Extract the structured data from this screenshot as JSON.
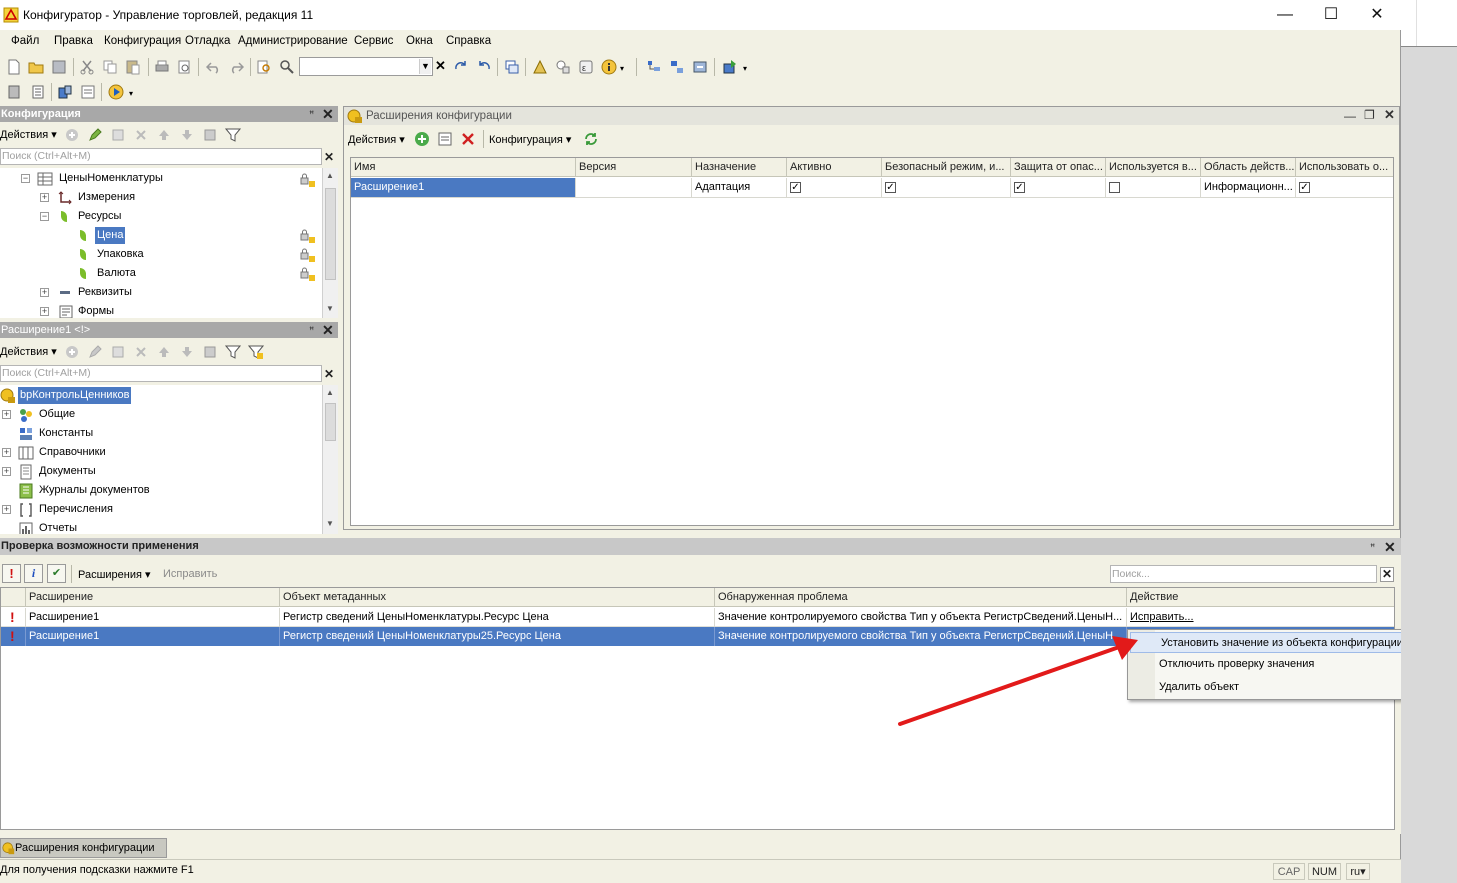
{
  "window": {
    "title": "Конфигуратор - Управление торговлей, редакция 11",
    "minimize": "—",
    "maximize": "☐",
    "close": "✕"
  },
  "menu": [
    "Файл",
    "Правка",
    "Конфигурация",
    "Отладка",
    "Администрирование",
    "Сервис",
    "Окна",
    "Справка"
  ],
  "config_panel": {
    "title": "Конфигурация",
    "actions": "Действия",
    "search_placeholder": "Поиск (Ctrl+Alt+M)",
    "tree": [
      {
        "label": "ЦеныНоменклатуры",
        "expander": "⊖",
        "locked": true
      },
      {
        "label": "Измерения",
        "expander": "⊕"
      },
      {
        "label": "Ресурсы",
        "expander": "⊖"
      },
      {
        "label": "Цена",
        "selected": true,
        "locked": true
      },
      {
        "label": "Упаковка",
        "locked": true
      },
      {
        "label": "Валюта",
        "locked": true
      },
      {
        "label": "Реквизиты",
        "expander": "⊕"
      },
      {
        "label": "Формы",
        "expander": "⊕"
      }
    ]
  },
  "ext_panel": {
    "title": "Расширение1 <!>",
    "actions": "Действия",
    "search_placeholder": "Поиск (Ctrl+Alt+M)",
    "tree": [
      {
        "label": "bpКонтрольЦенников",
        "selected": true
      },
      {
        "label": "Общие",
        "expander": "⊕"
      },
      {
        "label": "Константы"
      },
      {
        "label": "Справочники",
        "expander": "⊕"
      },
      {
        "label": "Документы",
        "expander": "⊕"
      },
      {
        "label": "Журналы документов"
      },
      {
        "label": "Перечисления",
        "expander": "⊕"
      },
      {
        "label": "Отчеты"
      }
    ]
  },
  "extensions_window": {
    "title": "Расширения конфигурации",
    "actions": "Действия",
    "configuration": "Конфигурация",
    "columns": [
      "Имя",
      "Версия",
      "Назначение",
      "Активно",
      "Безопасный режим, и...",
      "Защита от опас...",
      "Используется в...",
      "Область действ...",
      "Использовать о..."
    ],
    "row": {
      "name": "Расширение1",
      "version": "",
      "purpose": "Адаптация",
      "active": true,
      "safe_mode": true,
      "protection": true,
      "used_in": false,
      "scope": "Информационн...",
      "use_o": true
    }
  },
  "check_panel": {
    "title": "Проверка возможности применения",
    "extensions_btn": "Расширения",
    "fix_btn": "Исправить",
    "search_placeholder": "Поиск...",
    "columns": [
      "Расширение",
      "Объект метаданных",
      "Обнаруженная проблема",
      "Действие"
    ],
    "rows": [
      {
        "ext": "Расширение1",
        "object": "Регистр сведений ЦеныНоменклатуры.Ресурс Цена",
        "problem": "Значение контролируемого свойства Тип у объекта РегистрСведений.ЦеныН...",
        "action": "Исправить..."
      },
      {
        "ext": "Расширение1",
        "object": "Регистр сведений ЦеныНоменклатуры25.Ресурс Цена",
        "problem": "Значение контролируемого свойства Тип у объекта РегистрСведений.ЦеныН...",
        "action": ""
      }
    ]
  },
  "context_menu": [
    "Установить значение из объекта конфигурации",
    "Отключить проверку значения",
    "Удалить объект"
  ],
  "taskbar_tab": "Расширения конфигурации",
  "status": {
    "hint": "Для получения подсказки нажмите F1",
    "cap": "CAP",
    "num": "NUM",
    "lang": "ru"
  },
  "colors": {
    "selection": "#4a79c2",
    "arrow": "#e21a1a",
    "panel_header": "#a8a8a8",
    "chrome": "#f2f1e4"
  }
}
